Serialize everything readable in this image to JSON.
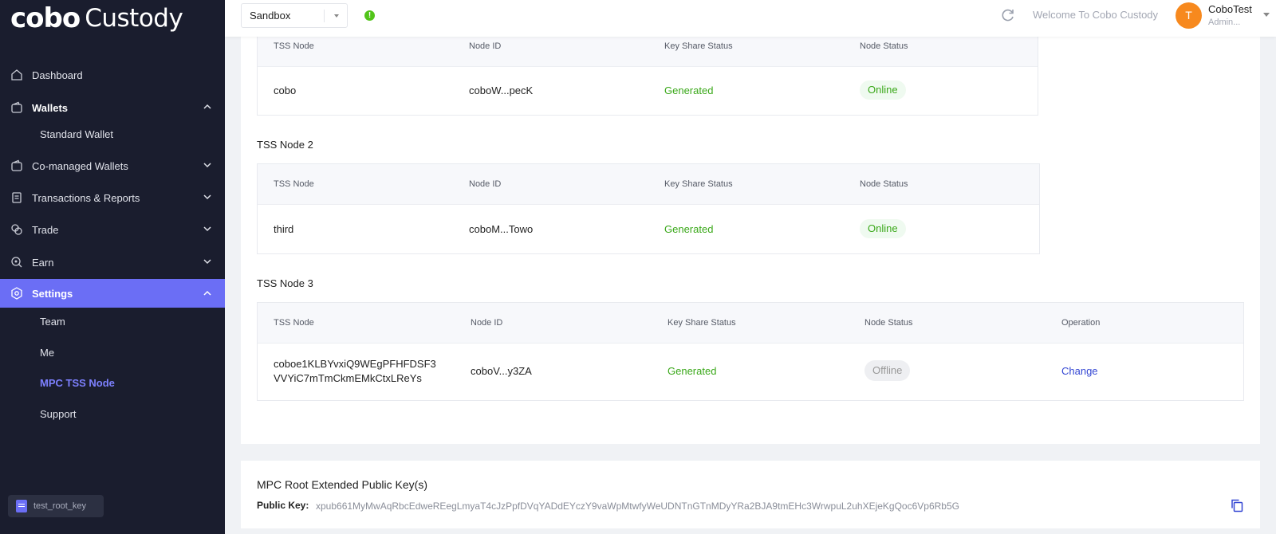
{
  "brand": {
    "logo": "cobo",
    "product": "Custody"
  },
  "sidebar": {
    "items": [
      {
        "label": "Dashboard"
      },
      {
        "label": "Wallets"
      },
      {
        "label": "Standard Wallet"
      },
      {
        "label": "Co-managed Wallets"
      },
      {
        "label": "Transactions & Reports"
      },
      {
        "label": "Trade"
      },
      {
        "label": "Earn"
      },
      {
        "label": "Settings"
      },
      {
        "label": "Team"
      },
      {
        "label": "Me"
      },
      {
        "label": "MPC TSS Node"
      },
      {
        "label": "Support"
      }
    ],
    "key_chip": "test_root_key"
  },
  "topbar": {
    "environment": "Sandbox",
    "info_icon": "!",
    "welcome": "Welcome To Cobo Custody",
    "user_initial": "T",
    "user_name": "CoboTest",
    "user_role": "Admin..."
  },
  "columns": {
    "tss_node": "TSS Node",
    "node_id": "Node ID",
    "key_share_status": "Key Share Status",
    "node_status": "Node Status",
    "operation": "Operation"
  },
  "nodes": [
    {
      "title": "",
      "tss_node": "cobo",
      "node_id": "coboW...pecK",
      "key_share_status": "Generated",
      "node_status": "Online"
    },
    {
      "title": "TSS Node 2",
      "tss_node": "third",
      "node_id": "coboM...Towo",
      "key_share_status": "Generated",
      "node_status": "Online"
    },
    {
      "title": "TSS Node 3",
      "tss_node_line1": "coboe1KLBYvxiQ9WEgPFHFDSF3",
      "tss_node_line2": "VVYiC7mTmCkmEMkCtxLReYs",
      "node_id": "coboV...y3ZA",
      "key_share_status": "Generated",
      "node_status": "Offline",
      "operation": "Change"
    }
  ],
  "public_key": {
    "title": "MPC Root Extended Public Key(s)",
    "label": "Public Key:",
    "value": "xpub661MyMwAqRbcEdweREegLmyaT4cJzPpfDVqYADdEYczY9vaWpMtwfyWeUDNTnGTnMDyYRa2BJA9tmEHc3WrwpuL2uhXEjeKgQoc6Vp6Rb5G"
  },
  "colors": {
    "sidebar_bg": "#1a1d2e",
    "accent": "#6b6ef5",
    "status_green": "#3aa819",
    "link_blue": "#3346d3"
  }
}
